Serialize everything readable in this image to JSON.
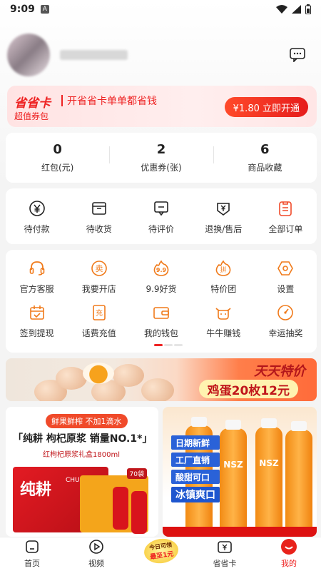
{
  "status_bar": {
    "time": "9:09"
  },
  "header": {
    "chat_icon": "chat-bubble-icon"
  },
  "sheng_ka": {
    "logo": "省省卡",
    "slogan": "开省省卡单单都省钱",
    "sub": "超值券包",
    "button": "¥1.80 立即开通",
    "accent": "#e8221b"
  },
  "stats": [
    {
      "value": "0",
      "label": "红包(元)"
    },
    {
      "value": "2",
      "label": "优惠券(张)"
    },
    {
      "value": "6",
      "label": "商品收藏"
    }
  ],
  "orders": [
    {
      "label": "待付款",
      "icon": "yen-coin-icon"
    },
    {
      "label": "待收货",
      "icon": "box-icon"
    },
    {
      "label": "待评价",
      "icon": "comment-icon"
    },
    {
      "label": "退换/售后",
      "icon": "refund-icon"
    },
    {
      "label": "全部订单",
      "icon": "clipboard-icon"
    }
  ],
  "services": [
    {
      "label": "官方客服",
      "icon": "headset-icon"
    },
    {
      "label": "我要开店",
      "icon": "sell-icon",
      "glyph": "卖"
    },
    {
      "label": "9.9好货",
      "icon": "fire-icon",
      "glyph": "9.9"
    },
    {
      "label": "特价团",
      "icon": "group-icon",
      "glyph": "拼"
    },
    {
      "label": "设置",
      "icon": "settings-icon"
    },
    {
      "label": "签到提现",
      "icon": "calendar-check-icon"
    },
    {
      "label": "话费充值",
      "icon": "phone-recharge-icon",
      "glyph": "充"
    },
    {
      "label": "我的钱包",
      "icon": "wallet-icon"
    },
    {
      "label": "牛牛赚钱",
      "icon": "cow-icon"
    },
    {
      "label": "幸运抽奖",
      "icon": "lucky-dial-icon"
    }
  ],
  "egg_banner": {
    "tag": "天天特价",
    "pill": "鸡蛋20枚12元"
  },
  "product_left": {
    "tag": "鲜果鲜榨 不加1滴水",
    "title": "「纯耕 枸杞原浆 销量NO.1*」",
    "sub": "红枸杞原浆礼盒1800ml",
    "brand": "纯耕",
    "brand_en": "CHUN GENG",
    "badge": "70袋"
  },
  "product_right": {
    "lines": [
      "日期新鲜",
      "工厂直销",
      "酸甜可口"
    ],
    "highlight": "冰镇爽口",
    "bottle_label": "NSZ"
  },
  "tabbar": [
    {
      "label": "首页",
      "icon": "home-icon"
    },
    {
      "label": "视频",
      "icon": "play-icon"
    },
    {
      "label": "",
      "icon": "promo-badge-icon",
      "promo_line1": "今日可领",
      "promo_line2": "最至1元"
    },
    {
      "label": "省省卡",
      "icon": "card-yen-icon"
    },
    {
      "label": "我的",
      "icon": "profile-icon",
      "active": true
    }
  ]
}
